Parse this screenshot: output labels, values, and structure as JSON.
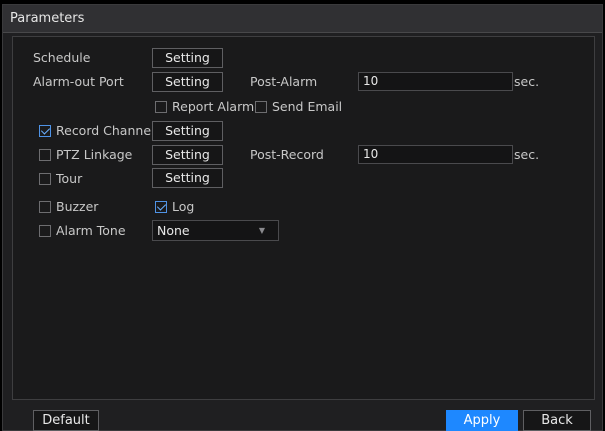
{
  "window": {
    "title": "Parameters"
  },
  "rows": {
    "schedule": {
      "label": "Schedule",
      "button": "Setting"
    },
    "alarm_out": {
      "label": "Alarm-out Port",
      "button": "Setting",
      "post_label": "Post-Alarm",
      "post_value": "10",
      "unit": "sec."
    },
    "notify": {
      "report_alarm": "Report Alarm",
      "report_alarm_checked": false,
      "send_email": "Send Email",
      "send_email_checked": false
    },
    "record_channel": {
      "label": "Record Channel",
      "checked": true,
      "button": "Setting"
    },
    "ptz": {
      "label": "PTZ Linkage",
      "checked": false,
      "button": "Setting",
      "post_label": "Post-Record",
      "post_value": "10",
      "unit": "sec."
    },
    "tour": {
      "label": "Tour",
      "checked": false,
      "button": "Setting"
    },
    "buzzer": {
      "label": "Buzzer",
      "checked": false
    },
    "log": {
      "label": "Log",
      "checked": true
    },
    "alarm_tone": {
      "label": "Alarm Tone",
      "checked": false,
      "value": "None",
      "arrow_icon": "dropdown-arrow-icon"
    }
  },
  "footer": {
    "default": "Default",
    "apply": "Apply",
    "back": "Back"
  },
  "colors": {
    "accent": "#1e88ff",
    "check": "#6cb0ff",
    "panel": "#1a1a1b"
  }
}
